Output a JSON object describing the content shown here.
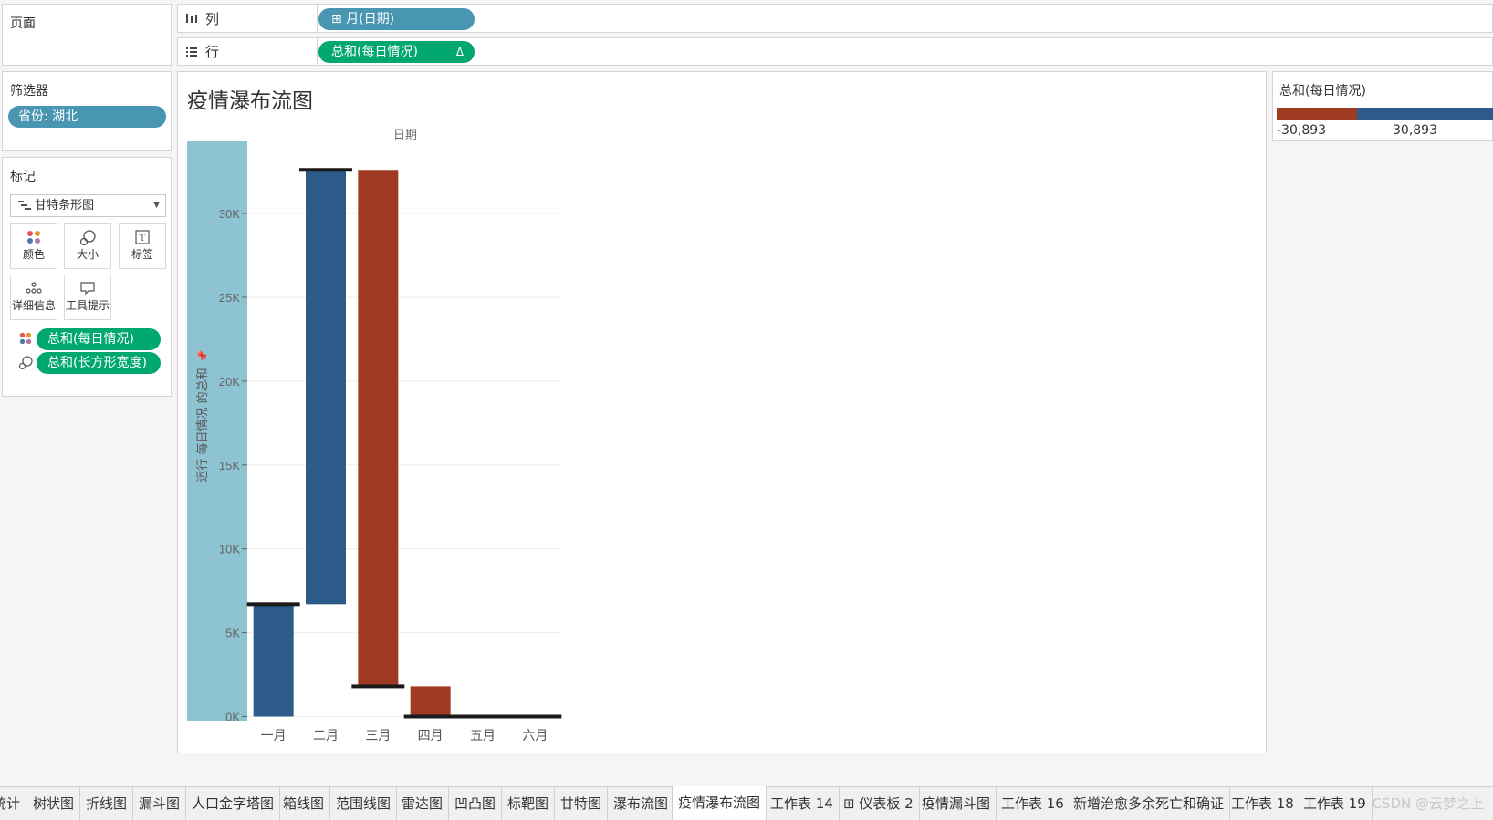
{
  "pages": {
    "title": "页面"
  },
  "shelves": {
    "columns": {
      "icon": "columns-icon",
      "label": "列",
      "pill": "⊞ 月(日期)"
    },
    "rows": {
      "icon": "rows-icon",
      "label": "行",
      "pill": "总和(每日情况)",
      "pill_suffix": "Δ"
    }
  },
  "filters": {
    "title": "筛选器",
    "items": [
      "省份: 湖北"
    ]
  },
  "marks": {
    "title": "标记",
    "type": "甘特条形图",
    "buttons": [
      {
        "icon": "color-icon",
        "label": "颜色"
      },
      {
        "icon": "size-icon",
        "label": "大小"
      },
      {
        "icon": "label-icon",
        "label": "标签"
      },
      {
        "icon": "detail-icon",
        "label": "详细信息"
      },
      {
        "icon": "tooltip-icon",
        "label": "工具提示"
      }
    ],
    "fields": [
      {
        "icon": "color-icon",
        "label": "总和(每日情况)"
      },
      {
        "icon": "size-icon",
        "label": "总和(长方形宽度)"
      }
    ]
  },
  "legend": {
    "title": "总和(每日情况)",
    "min_label": "-30,893",
    "max_label": "30,893",
    "colors": {
      "negative": "#9e3b22",
      "positive": "#2c5b8a"
    }
  },
  "colors": {
    "positive": "#2c5b8a",
    "negative": "#9e3b22",
    "axis_band": "#8ec4d2",
    "total_mark": "#1a1a1a"
  },
  "chart_data": {
    "type": "bar",
    "subtype": "waterfall (gantt bars)",
    "title": "疫情瀑布流图",
    "header_label": "日期",
    "ylabel": "运行 每日情况 的总和",
    "ylabel_pin": "📌",
    "categories": [
      "一月",
      "二月",
      "三月",
      "四月",
      "五月",
      "六月"
    ],
    "yticks": [
      0,
      5000,
      10000,
      15000,
      20000,
      25000,
      30000
    ],
    "ytick_labels": [
      "0K",
      "5K",
      "10K",
      "15K",
      "20K",
      "25K",
      "30K"
    ],
    "ylim": [
      -300,
      34300
    ],
    "grid": true,
    "series": [
      {
        "name": "总和(每日情况)",
        "bars": [
          {
            "category": "一月",
            "start": 0,
            "end": 6700,
            "running_total": 6700
          },
          {
            "category": "二月",
            "start": 6700,
            "end": 32600,
            "running_total": 32600
          },
          {
            "category": "三月",
            "start": 32600,
            "end": 1800,
            "running_total": 1800
          },
          {
            "category": "四月",
            "start": 1800,
            "end": 0,
            "running_total": 0
          },
          {
            "category": "五月",
            "start": 0,
            "end": 0,
            "running_total": 0
          },
          {
            "category": "六月",
            "start": 0,
            "end": 0,
            "running_total": 0
          }
        ]
      }
    ]
  },
  "tabs": {
    "items": [
      "统计",
      "树状图",
      "折线图",
      "漏斗图",
      "人口金字塔图",
      "箱线图",
      "范围线图",
      "雷达图",
      "凹凸图",
      "标靶图",
      "甘特图",
      "瀑布流图",
      "疫情瀑布流图",
      "工作表 14",
      "⊞ 仪表板 2",
      "疫情漏斗图",
      "工作表 16",
      "新增治愈多余死亡和确证",
      "工作表 18",
      "工作表 19"
    ],
    "active_index": 12,
    "watermark": "CSDN @云梦之上"
  }
}
